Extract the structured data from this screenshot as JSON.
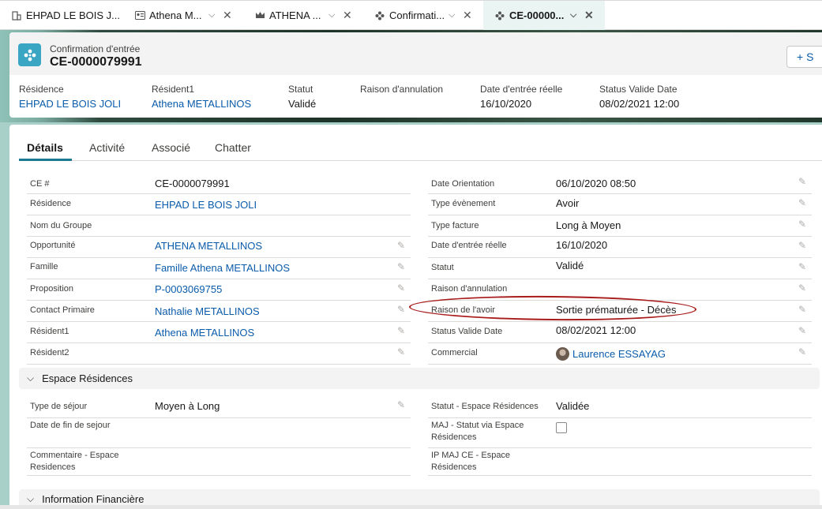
{
  "tabs": [
    {
      "label": "EHPAD LE BOIS J...",
      "icon": "building-icon"
    },
    {
      "label": "Athena M...",
      "icon": "contact-card-icon"
    },
    {
      "label": "ATHENA ...",
      "icon": "crown-icon"
    },
    {
      "label": "Confirmati...",
      "icon": "flower-icon"
    },
    {
      "label": "CE-00000...",
      "icon": "flower-icon"
    }
  ],
  "header": {
    "object_type": "Confirmation d'entrée",
    "record_name": "CE-0000079991",
    "follow_label": "+ S",
    "fields": [
      {
        "label": "Résidence",
        "value": "EHPAD LE BOIS JOLI"
      },
      {
        "label": "Résident1",
        "value": "Athena METALLINOS"
      },
      {
        "label": "Statut",
        "value": "Validé"
      },
      {
        "label": "Raison d'annulation",
        "value": ""
      },
      {
        "label": "Date d'entrée réelle",
        "value": "16/10/2020"
      },
      {
        "label": "Status Valide Date",
        "value": "08/02/2021 12:00"
      }
    ]
  },
  "record_tabs": [
    "Détails",
    "Activité",
    "Associé",
    "Chatter"
  ],
  "details_left": [
    {
      "label": "CE #",
      "value": "CE-0000079991"
    },
    {
      "label": "Résidence",
      "value": "EHPAD LE BOIS JOLI"
    },
    {
      "label": "Nom du Groupe",
      "value": ""
    },
    {
      "label": "Opportunité",
      "value": "ATHENA METALLINOS"
    },
    {
      "label": "Famille",
      "value": "Famille Athena METALLINOS"
    },
    {
      "label": "Proposition",
      "value": "P-0003069755"
    },
    {
      "label": "Contact Primaire",
      "value": "Nathalie METALLINOS"
    },
    {
      "label": "Résident1",
      "value": "Athena METALLINOS"
    },
    {
      "label": "Résident2",
      "value": ""
    }
  ],
  "details_right": [
    {
      "label": "Date Orientation",
      "value": "06/10/2020 08:50"
    },
    {
      "label": "Type évènement",
      "value": "Avoir"
    },
    {
      "label": "Type facture",
      "value": "Long à Moyen"
    },
    {
      "label": "Date d'entrée réelle",
      "value": "16/10/2020"
    },
    {
      "label": "Statut",
      "value": "Validé"
    },
    {
      "label": "Raison d'annulation",
      "value": ""
    },
    {
      "label": "Raison de l'avoir",
      "value": "Sortie prématurée - Décès"
    },
    {
      "label": "Status Valide Date",
      "value": "08/02/2021 12:00"
    },
    {
      "label": "Commercial",
      "value": "Laurence ESSAYAG"
    }
  ],
  "section_espace": {
    "title": "Espace Résidences",
    "left": [
      {
        "label": "Type de séjour",
        "value": "Moyen à Long"
      },
      {
        "label": "Date de fin de sejour",
        "value": ""
      },
      {
        "label": "Commentaire - Espace Residences",
        "value": ""
      }
    ],
    "right": [
      {
        "label": "Statut - Espace Résidences",
        "value": "Validée"
      },
      {
        "label": "MAJ - Statut via Espace Résidences",
        "value": ""
      },
      {
        "label": "IP MAJ CE - Espace Résidences",
        "value": ""
      }
    ]
  },
  "section_finance": {
    "title": "Information Financière"
  },
  "colors": {
    "link": "#0b5cab",
    "accent": "#1b7a8f",
    "highlight": "#a81c1c"
  }
}
